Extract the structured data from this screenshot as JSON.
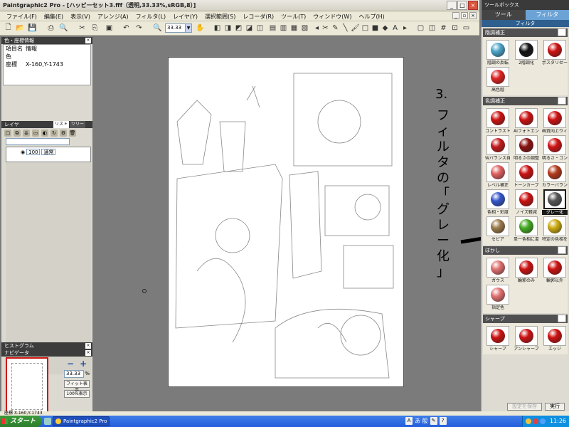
{
  "window": {
    "title": "Paintgraphic2 Pro - [ハッピーセット3.fff（透明,33.33%,sRGB,8）]"
  },
  "menubar": {
    "items": [
      "ファイル(F)",
      "編集(E)",
      "表示(V)",
      "アレンジ(A)",
      "フィルタ(L)",
      "レイヤ(Y)",
      "選択範囲(S)",
      "レコーダ(R)",
      "ツール(T)",
      "ウィンドウ(W)",
      "ヘルプ(H)"
    ]
  },
  "toolbar": {
    "zoom_value": "33.33"
  },
  "info_panel": {
    "title": "色・座標情報",
    "rows": [
      {
        "key": "項目名",
        "value": "情報"
      },
      {
        "key": "色",
        "value": ""
      },
      {
        "key": "座標",
        "value": "X-160,Y-1743"
      }
    ]
  },
  "layer_panel": {
    "title": "レイヤ",
    "tabs": [
      "リスト",
      "ツリー"
    ],
    "opacity": "100",
    "blend_mode": "通常"
  },
  "history_panel": {
    "title": "ヒストグラム"
  },
  "navigator": {
    "title": "ナビゲータ",
    "zoom": "33.33",
    "zoom_unit": "%",
    "fit_button": "フィット表示",
    "hundred_button": "100%表示"
  },
  "overlay_annotation": {
    "step": "3.",
    "vertical_text": [
      "フ",
      "ィ",
      "ル",
      "タ",
      "の",
      "「",
      "グ",
      "レ",
      "ー",
      "化",
      "」"
    ]
  },
  "toolbox": {
    "title": "ツールボックス",
    "tabs": [
      "ツール",
      "フィルタ"
    ],
    "active_tab": "フィルタ",
    "subtab": "フィルタ",
    "sections": [
      {
        "name": "階調補正",
        "items": [
          {
            "label": "階調の反転",
            "color": "#4aa3c8"
          },
          {
            "label": "2階調化",
            "color": "#111111"
          },
          {
            "label": "ポスタリゼーション",
            "color": "#cc1111"
          },
          {
            "label": "高色階",
            "color": "#dd2222"
          }
        ]
      },
      {
        "name": "色調補正",
        "items": [
          {
            "label": "コントラストの自動補正",
            "color": "#cc1111"
          },
          {
            "label": "AIフォトエンハンサー",
            "color": "#cc1111"
          },
          {
            "label": "画質向上ウィザード",
            "color": "#cc1111"
          },
          {
            "label": "Wバランス自動補正",
            "color": "#c21a1a"
          },
          {
            "label": "明るさの調整",
            "color": "#8a1010"
          },
          {
            "label": "明るさ・コントラスト",
            "color": "#d01414"
          },
          {
            "label": "レベル補正",
            "color": "#e06060"
          },
          {
            "label": "トーンカーブ",
            "color": "#cc1111"
          },
          {
            "label": "カラーバランス",
            "color": "#b33a1a"
          },
          {
            "label": "色相・彩度",
            "color": "#3355cc"
          },
          {
            "label": "ノイズ軽減",
            "color": "#cc1111"
          },
          {
            "label": "グレー化",
            "color": "#555555"
          },
          {
            "label": "セピア",
            "color": "#9b7a4a"
          },
          {
            "label": "単一色相に変換",
            "color": "#44aa22"
          },
          {
            "label": "特定の色相を変換",
            "color": "#ccaa11"
          }
        ]
      },
      {
        "name": "ぼかし",
        "items": [
          {
            "label": "ガウス",
            "color": "#e07070"
          },
          {
            "label": "輪郭のみ",
            "color": "#cc1111"
          },
          {
            "label": "輪郭以外",
            "color": "#cc1111"
          },
          {
            "label": "指定色",
            "color": "#e07070"
          }
        ]
      },
      {
        "name": "シャープ",
        "items": [
          {
            "label": "シャープ",
            "color": "#cc1111"
          },
          {
            "label": "アンシャープ",
            "color": "#cc1111"
          },
          {
            "label": "エッジ",
            "color": "#cc1111"
          }
        ]
      }
    ],
    "buttons": {
      "settings": "設定を保存",
      "run": "実行"
    }
  },
  "statusbar": {
    "text": "座標 X-160,Y-1743"
  },
  "taskbar": {
    "start_label": "スタート",
    "task_label": "Paintgraphic2 Pro - [",
    "lang_text": "あ 般",
    "clock": "11:26"
  }
}
